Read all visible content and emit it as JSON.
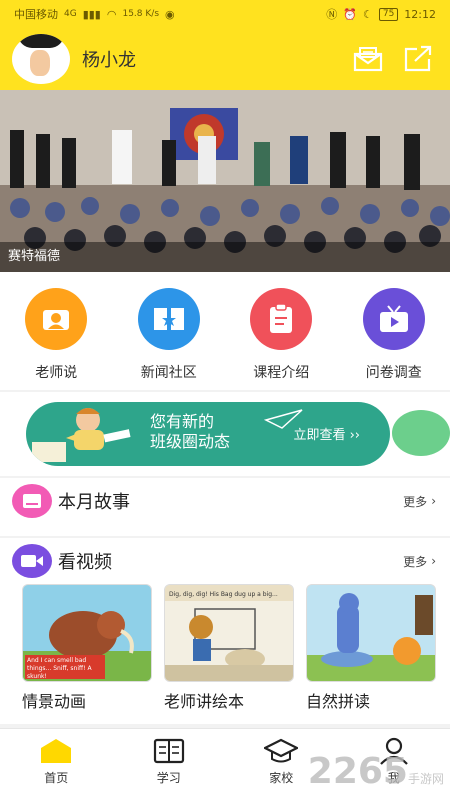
{
  "status_bar": {
    "carrier": "中国移动",
    "network": "4G",
    "speed": "15.8 K/s",
    "battery": "75",
    "time": "12:12"
  },
  "header": {
    "username": "杨小龙",
    "icons": [
      "message-icon",
      "share-icon"
    ]
  },
  "banner": {
    "caption": "赛特福德"
  },
  "quick_menu": [
    {
      "label": "老师说",
      "icon": "teacher-icon",
      "color": "#ffa21a"
    },
    {
      "label": "新闻社区",
      "icon": "book-star-icon",
      "color": "#2d95e8"
    },
    {
      "label": "课程介绍",
      "icon": "clipboard-icon",
      "color": "#f0515a"
    },
    {
      "label": "问卷调查",
      "icon": "tv-icon",
      "color": "#6a4fd8"
    }
  ],
  "promo": {
    "message_line1": "您有新的",
    "message_line2": "班级圈动态",
    "link": "立即查看",
    "color": "#2ea58b"
  },
  "story_section": {
    "title": "本月故事",
    "more": "更多",
    "icon_color": "#f25bb5"
  },
  "video_section": {
    "title": "看视频",
    "more": "更多",
    "icon_color": "#7b4ee0",
    "items": [
      {
        "label": "情景动画",
        "caption": "And I can smell bad things... Sniff, sniff! A skunk!"
      },
      {
        "label": "老师讲绘本",
        "caption": "Dig, dig, dig! His Bag dug up a big..."
      },
      {
        "label": "自然拼读",
        "caption": ""
      }
    ]
  },
  "tab_bar": [
    {
      "label": "首页",
      "icon": "home-icon",
      "active": true
    },
    {
      "label": "学习",
      "icon": "book-icon",
      "active": false
    },
    {
      "label": "家校",
      "icon": "graduation-cap-icon",
      "active": false
    },
    {
      "label": "我",
      "icon": "person-icon",
      "active": false
    }
  ],
  "watermark": {
    "number": "2265",
    "text": "手游网"
  }
}
